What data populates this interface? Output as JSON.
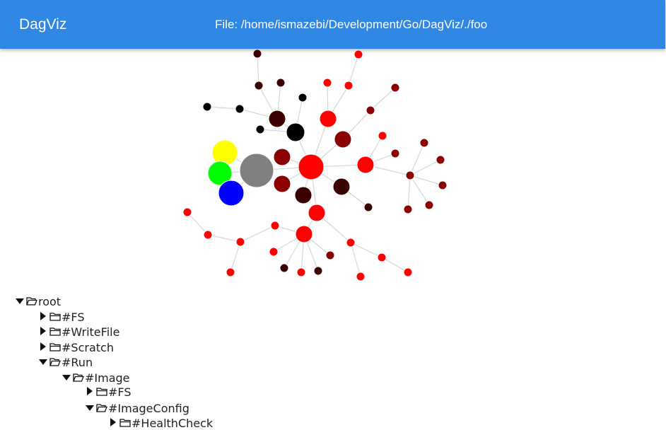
{
  "header": {
    "title": "DagViz",
    "file_path": "File: /home/ismazebi/Development/Go/DagViz/./foo",
    "color": "#2f86e3"
  },
  "graph": {
    "node_colors": {
      "red": "#ff0000",
      "dark_red": "#8b0000",
      "very_dark_red": "#3a0000",
      "black": "#000000",
      "gray": "#808080",
      "yellow": "#ffff00",
      "green": "#00ff00",
      "blue": "#0000ff"
    }
  },
  "tree": {
    "items": [
      {
        "label": "root",
        "expanded": true,
        "icon": "folder-open-icon"
      },
      {
        "label": "#FS",
        "expanded": false,
        "icon": "folder-icon"
      },
      {
        "label": "#WriteFile",
        "expanded": false,
        "icon": "folder-icon"
      },
      {
        "label": "#Scratch",
        "expanded": false,
        "icon": "folder-icon"
      },
      {
        "label": "#Run",
        "expanded": true,
        "icon": "folder-open-icon"
      },
      {
        "label": "#Image",
        "expanded": true,
        "icon": "folder-open-icon"
      },
      {
        "label": "#FS",
        "expanded": false,
        "icon": "folder-icon"
      },
      {
        "label": "#ImageConfig",
        "expanded": true,
        "icon": "folder-open-icon"
      },
      {
        "label": "#HealthCheck",
        "expanded": false,
        "icon": "folder-icon"
      }
    ]
  }
}
